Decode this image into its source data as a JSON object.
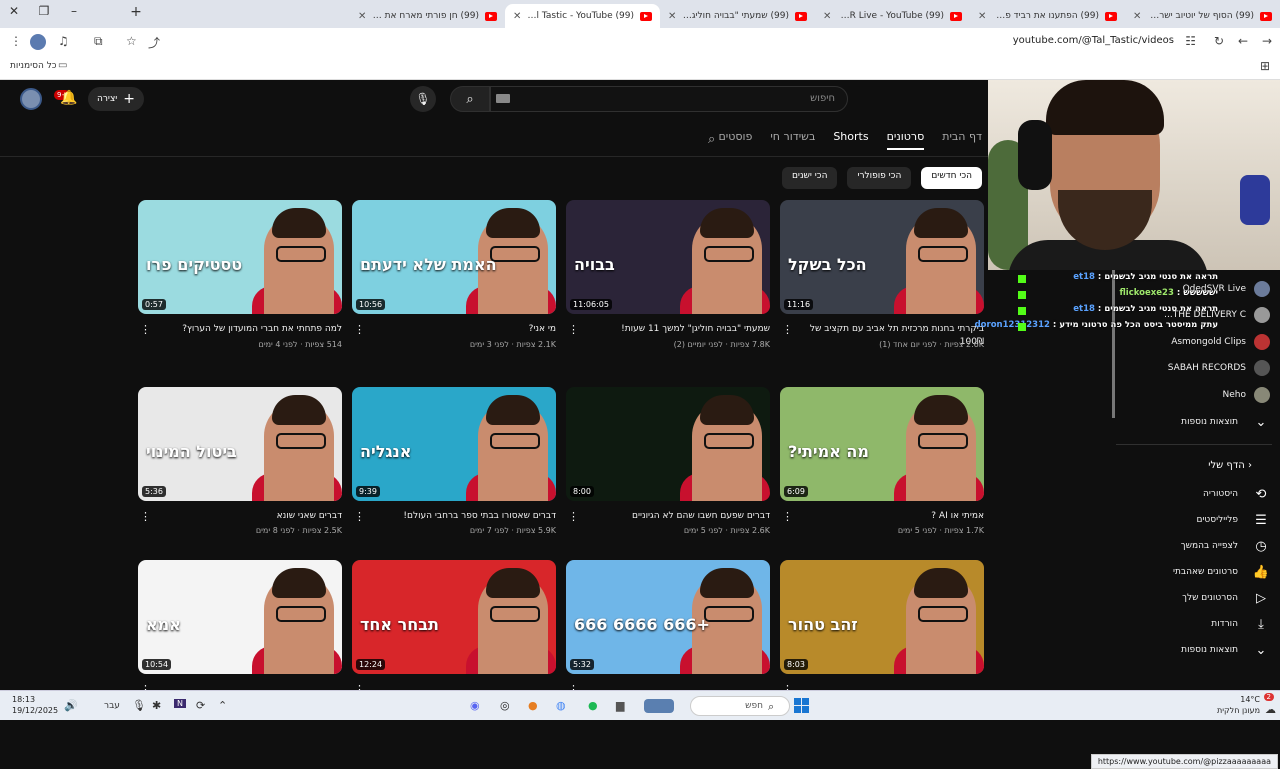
{
  "browser": {
    "tabs": [
      {
        "title": "(99) הסוף של יוטיוב ישראל? (ג'"
      },
      {
        "title": "(99) הפתענו את רביד פלוטניק"
      },
      {
        "title": "(99) OdedSVR Live - YouTube"
      },
      {
        "title": "(99) שמעתי \"בבויה חוליגן\" למש"
      },
      {
        "title": "(99) Tal Tastic - YouTube"
      },
      {
        "title": "(99) חן פורתי מארח את אלמוג ג"
      }
    ],
    "new_tab": "+",
    "window_min": "–",
    "window_restore": "❐",
    "window_close": "✕",
    "url": "youtube.com/@Tal_Tastic/videos",
    "bookmarks_all": "כל הסימניות"
  },
  "youtube": {
    "notif_count": "9+",
    "create_label": "יצירה",
    "search_placeholder": "חיפוש",
    "channel_tabs": [
      "דף הבית",
      "סרטונים",
      "Shorts",
      "בשידור חי",
      "פוסטים"
    ],
    "selected_tab": "סרטונים",
    "chips": [
      "הכי חדשים",
      "הכי פופולרי",
      "הכי ישנים"
    ],
    "videos": [
      {
        "title": "ביקרתי בחנות מרכזית תל אביב עם תקציב של 100₪",
        "views": "2.6K צפיות",
        "age": "לפני יום אחד (1)",
        "duration": "11:16",
        "thumb_text": "הכל בשקל",
        "bg": "#3a3f4a"
      },
      {
        "title": "שמעתי \"בבויה חוליגן\" למשך 11 שעות!",
        "views": "7.8K צפיות",
        "age": "לפני יומיים (2)",
        "duration": "11:06:05",
        "thumb_text": "בבויה",
        "bg": "#2b2438"
      },
      {
        "title": "מי אני?",
        "views": "2.1K צפיות",
        "age": "לפני 3 ימים",
        "duration": "10:56",
        "thumb_text": "האמת שלא ידעתם",
        "bg": "#7ed0e0"
      },
      {
        "title": "למה פתחתי את חברי המועדון של הערוץ?",
        "views": "514 צפיות",
        "age": "לפני 4 ימים",
        "duration": "0:57",
        "thumb_text": "טסטיקים פרו",
        "bg": "#9bdbe0"
      },
      {
        "title": "אמיתי או AI ?",
        "views": "1.7K צפיות",
        "age": "לפני 5 ימים",
        "duration": "6:09",
        "thumb_text": "מה אמיתי?",
        "bg": "#8fb86a"
      },
      {
        "title": "דברים שפעם חשבו שהם לא הגיוניים",
        "views": "2.6K צפיות",
        "age": "לפני 5 ימים",
        "duration": "8:00",
        "thumb_text": "",
        "bg": "#0e1a10"
      },
      {
        "title": "דברים שאסורו בבתי ספר ברחבי העולם!",
        "views": "5.9K צפיות",
        "age": "לפני 7 ימים",
        "duration": "9:39",
        "thumb_text": "אנגליה",
        "bg": "#2aa7c9"
      },
      {
        "title": "דברים שאני שונא",
        "views": "2.5K צפיות",
        "age": "לפני 8 ימים",
        "duration": "5:36",
        "thumb_text": "ביטול המינוי",
        "bg": "#e8e8e8"
      },
      {
        "title": "",
        "views": "",
        "age": "",
        "duration": "8:03",
        "thumb_text": "זהב טהור",
        "bg": "#b88a2a"
      },
      {
        "title": "",
        "views": "",
        "age": "",
        "duration": "5:32",
        "thumb_text": "+666 6666 666",
        "bg": "#6fb6e8"
      },
      {
        "title": "",
        "views": "",
        "age": "",
        "duration": "12:24",
        "thumb_text": "תבחר אחד",
        "bg": "#d8262a"
      },
      {
        "title": "",
        "views": "",
        "age": "",
        "duration": "10:54",
        "thumb_text": "אמא",
        "bg": "#f4f4f4"
      }
    ],
    "subscriptions": [
      {
        "name": "OdedSVR Live"
      },
      {
        "name": "THE DELIVERY C..."
      },
      {
        "name": "Asmongold Clips"
      },
      {
        "name": "SABAH RECORDS"
      },
      {
        "name": "Neho"
      }
    ],
    "show_more": "תוצאות נוספות",
    "you_section": "הדף שלי",
    "you_items": [
      {
        "label": "היסטוריה",
        "icon": "history-icon",
        "glyph": "⟲"
      },
      {
        "label": "פלייליסטים",
        "icon": "playlist-icon",
        "glyph": "☰"
      },
      {
        "label": "לצפייה בהמשך",
        "icon": "clock-icon",
        "glyph": "◷"
      },
      {
        "label": "סרטונים שאהבתי",
        "icon": "like-icon",
        "glyph": "👍"
      },
      {
        "label": "הסרטונים שלך",
        "icon": "video-icon",
        "glyph": "▷"
      },
      {
        "label": "הורדות",
        "icon": "download-icon",
        "glyph": "⤓"
      },
      {
        "label": "תוצאות נוספות",
        "icon": "chevron-down-icon",
        "glyph": "⌄"
      }
    ],
    "status_url": "https://www.youtube.com/@pizzaaaaaaaaa"
  },
  "chat": [
    {
      "user": "et18",
      "msg": "תראה את סנטי מגיב לבשמים",
      "green": false
    },
    {
      "user": "flickoexe23",
      "msg": "יששששש",
      "green": true
    },
    {
      "user": "et18",
      "msg": "תראה את סנטי מגיב לבשמים",
      "green": false
    },
    {
      "user": "doron12312312",
      "msg": "עתק ממיסטר ביסט הכל פה סרטוני מידע",
      "green": false
    }
  ],
  "taskbar": {
    "time": "18:13",
    "date": "19/12/2025",
    "lang": "עבר",
    "search": "חפש",
    "temp": "14°C",
    "weather": "מעונן חלקית",
    "notif": "2"
  },
  "colors": {
    "youtube_red": "#ff0000",
    "bg": "#0f0f0f",
    "live_green": "#53fc18"
  }
}
